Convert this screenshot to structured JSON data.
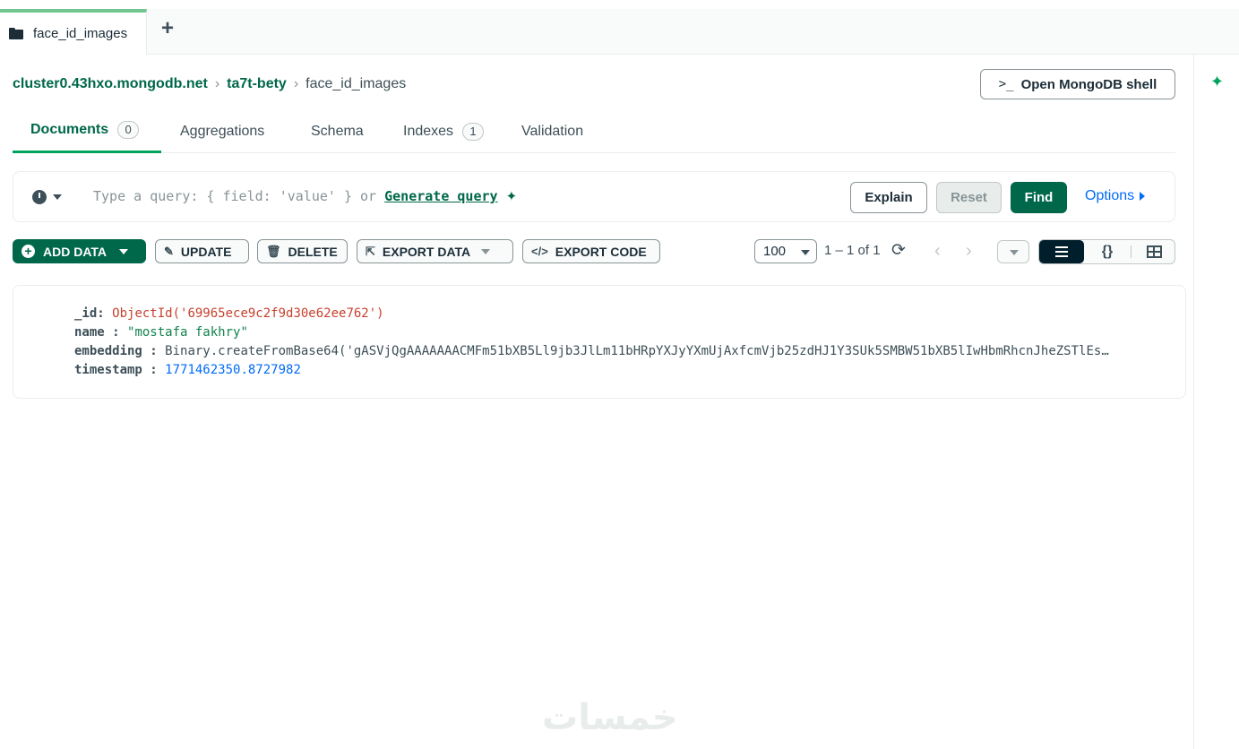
{
  "tab": {
    "label": "face_id_images",
    "new_tab_icon": "plus-icon"
  },
  "breadcrumb": [
    "cluster0.43hxo.mongodb.net",
    "ta7t-bety",
    "face_id_images"
  ],
  "shell_button": {
    "prompt": ">_",
    "label": "Open MongoDB shell"
  },
  "nav_tabs": {
    "documents": {
      "label": "Documents",
      "count": "0"
    },
    "aggregations": {
      "label": "Aggregations"
    },
    "schema": {
      "label": "Schema"
    },
    "indexes": {
      "label": "Indexes",
      "count": "1"
    },
    "validation": {
      "label": "Validation"
    }
  },
  "query": {
    "placeholder": "Type a query: { field: 'value' } or",
    "generate_label": "Generate query",
    "explain": "Explain",
    "reset": "Reset",
    "find": "Find",
    "options": "Options"
  },
  "toolbar": {
    "add_data": "ADD DATA",
    "update": "UPDATE",
    "delete": "DELETE",
    "export_data": "EXPORT DATA",
    "export_code": "EXPORT CODE",
    "page_size": "100",
    "range": "1 – 1 of 1"
  },
  "document": {
    "id_key": "_id",
    "id_value": "ObjectId('69965ece9c2f9d30e62ee762')",
    "name_key": "name",
    "name_value": "\"mostafa fakhry\"",
    "embedding_key": "embedding",
    "embedding_value": "Binary.createFromBase64('gASVjQgAAAAAAACMFm51bXB5Ll9jb3JlLm11bHRpYXJyYXmUjAxfcmVjb25zdHJ1Y3SUk5SMBW51bXB5lIwHbmRhcnJheZSTlEs…",
    "timestamp_key": "timestamp",
    "timestamp_value": "1771462350.8727982"
  },
  "colors": {
    "brand": "#00684a",
    "accent": "#00a35c",
    "link": "#016bf8"
  },
  "watermark": "خمسات"
}
